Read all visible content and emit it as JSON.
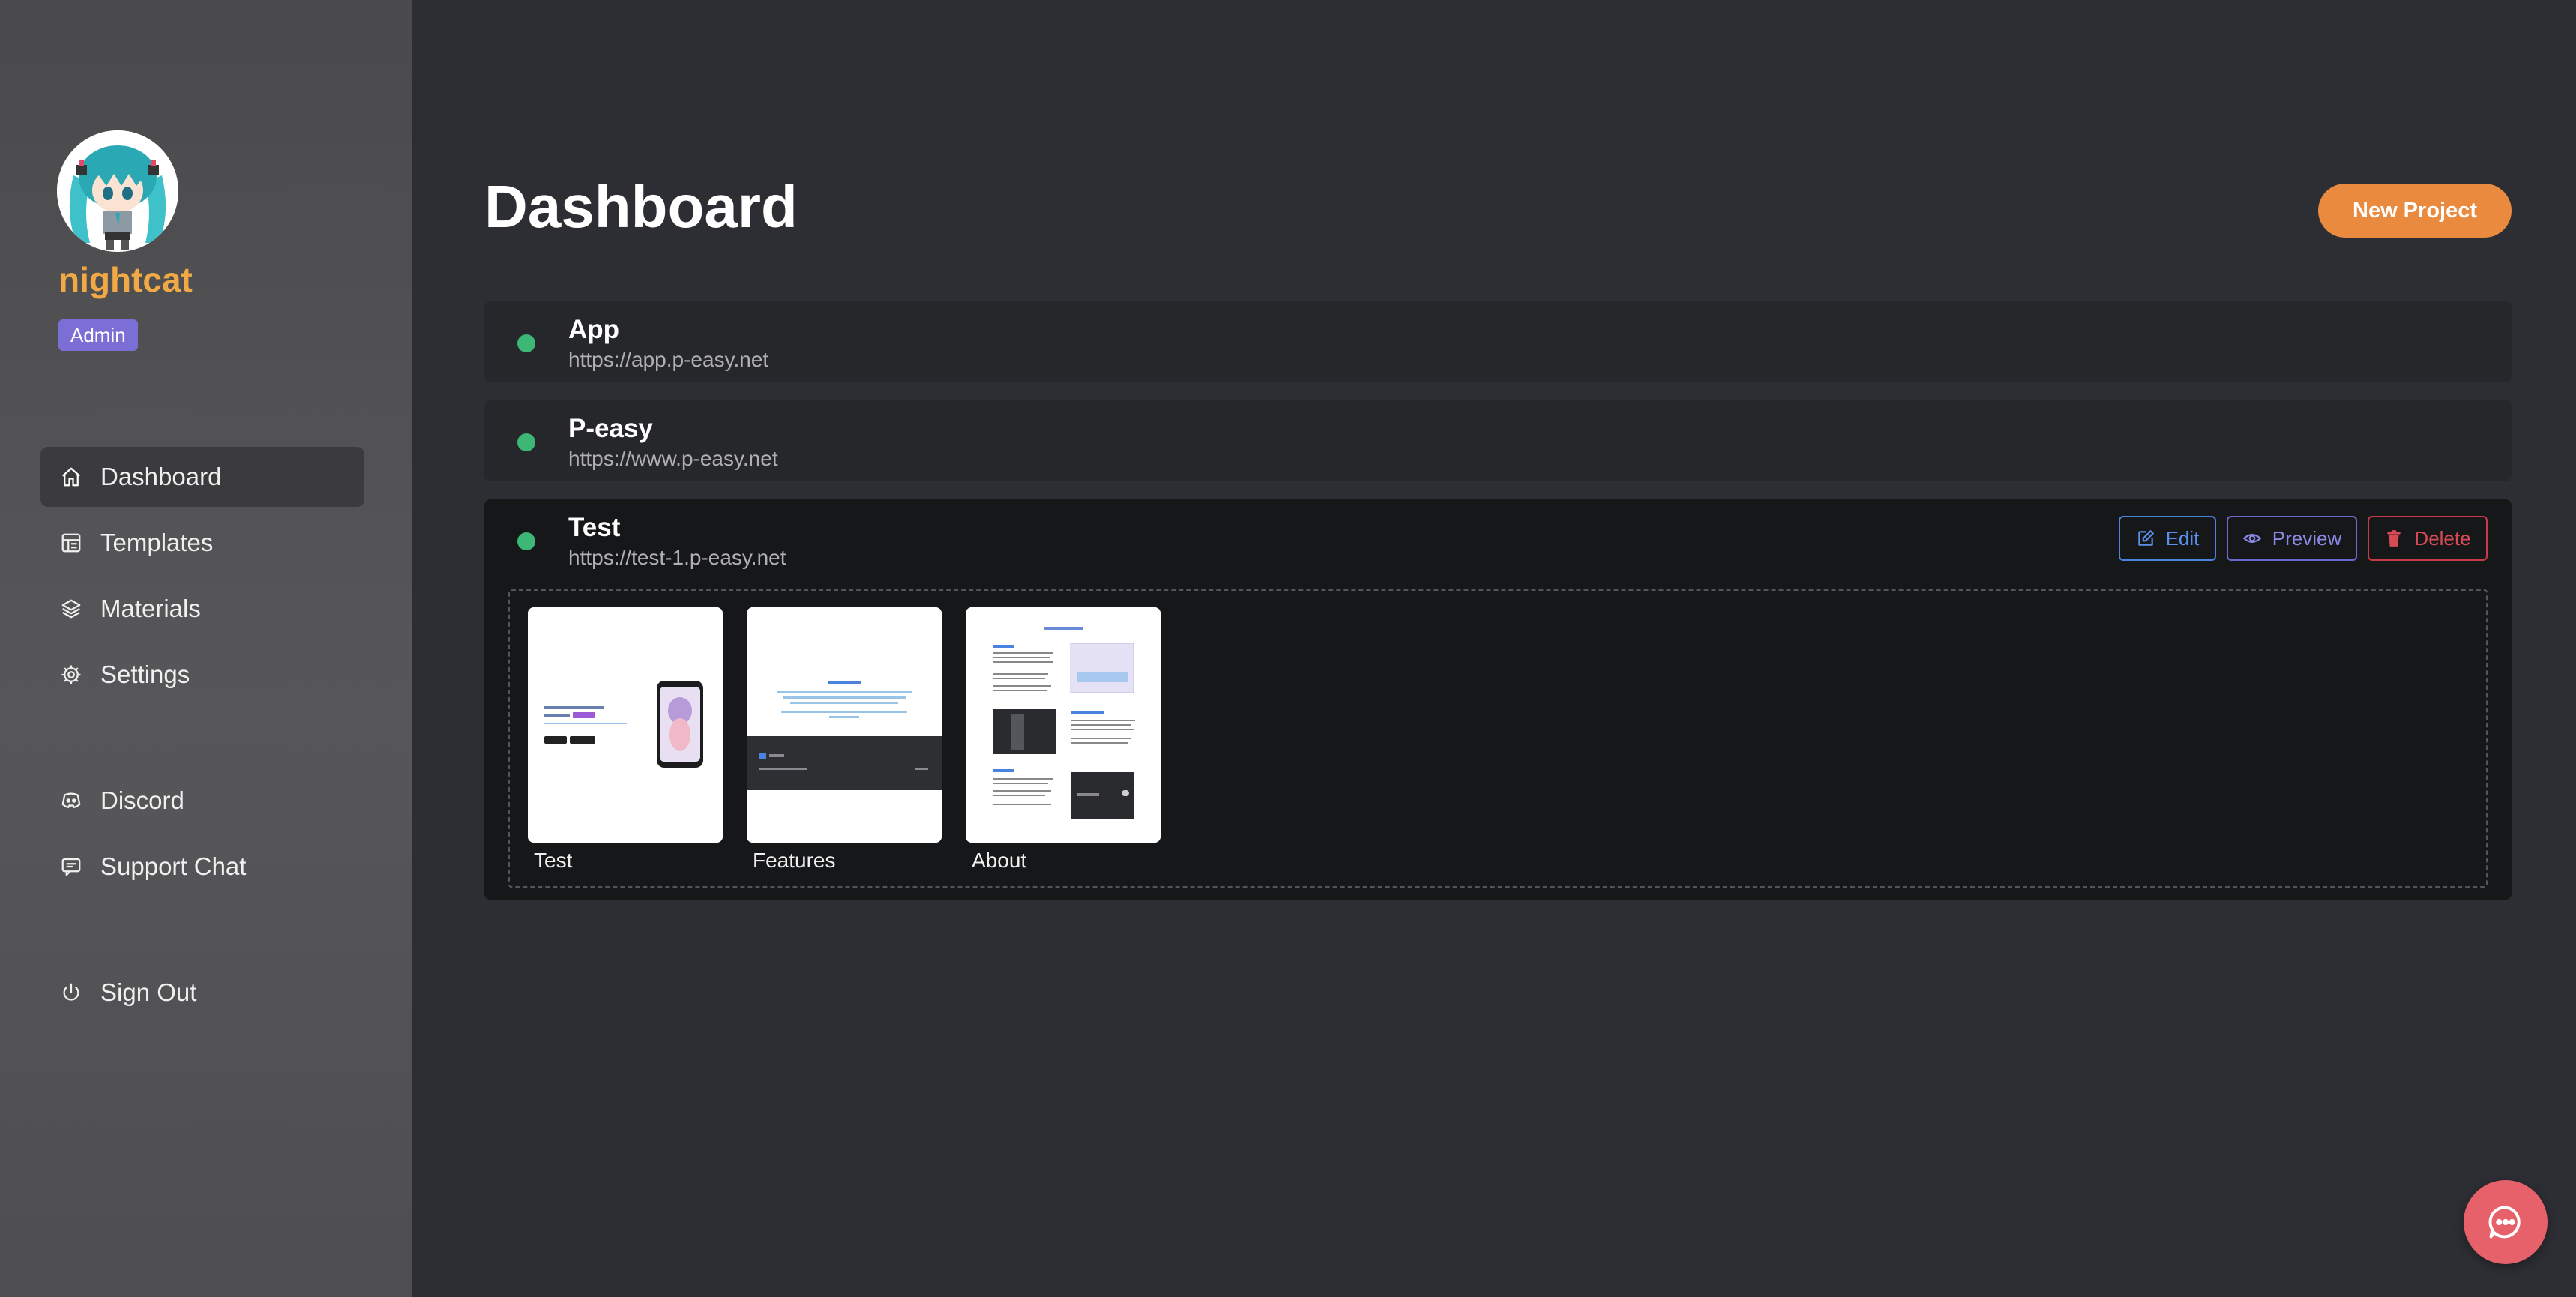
{
  "user": {
    "name": "nightcat",
    "role": "Admin"
  },
  "sidebar": {
    "items": [
      {
        "label": "Dashboard",
        "icon": "home-icon",
        "active": true
      },
      {
        "label": "Templates",
        "icon": "templates-icon",
        "active": false
      },
      {
        "label": "Materials",
        "icon": "layers-icon",
        "active": false
      },
      {
        "label": "Settings",
        "icon": "gear-icon",
        "active": false
      },
      {
        "label": "Discord",
        "icon": "discord-icon",
        "active": false
      },
      {
        "label": "Support Chat",
        "icon": "chat-icon",
        "active": false
      },
      {
        "label": "Sign Out",
        "icon": "power-icon",
        "active": false
      }
    ]
  },
  "header": {
    "title": "Dashboard",
    "new_project_label": "New Project"
  },
  "projects": [
    {
      "name": "App",
      "url": "https://app.p-easy.net",
      "status": "online"
    },
    {
      "name": "P-easy",
      "url": "https://www.p-easy.net",
      "status": "online"
    },
    {
      "name": "Test",
      "url": "https://test-1.p-easy.net",
      "status": "online",
      "actions": {
        "edit": "Edit",
        "preview": "Preview",
        "delete": "Delete"
      },
      "pages": [
        {
          "label": "Test"
        },
        {
          "label": "Features"
        },
        {
          "label": "About"
        }
      ]
    }
  ],
  "colors": {
    "accent": "#ea8a3e",
    "username": "#f0a945",
    "badge": "#7b6fd6",
    "status_online": "#3cb775",
    "edit": "#4a82e0",
    "preview": "#6a6ad0",
    "delete": "#c53a46",
    "chat_fab": "#e6616a"
  },
  "support_fab_icon": "chat-bubble-icon"
}
